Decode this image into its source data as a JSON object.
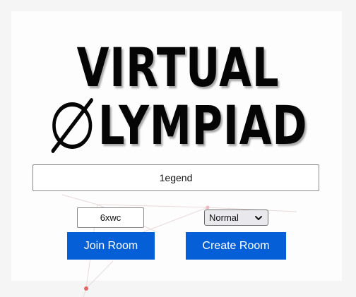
{
  "header": {
    "title_line1": "VIRTUAL",
    "title_line2_rest": "LYMPIAD"
  },
  "form": {
    "name_value": "1egend",
    "room_code_value": "6xwc",
    "mode_selected": "Normal",
    "join_label": "Join Room",
    "create_label": "Create Room"
  },
  "colors": {
    "button_bg": "#0560d8",
    "background_node": "#e05555"
  },
  "icons": {
    "title_o": "empty-set-icon",
    "select_arrow": "chevron-down-icon"
  }
}
